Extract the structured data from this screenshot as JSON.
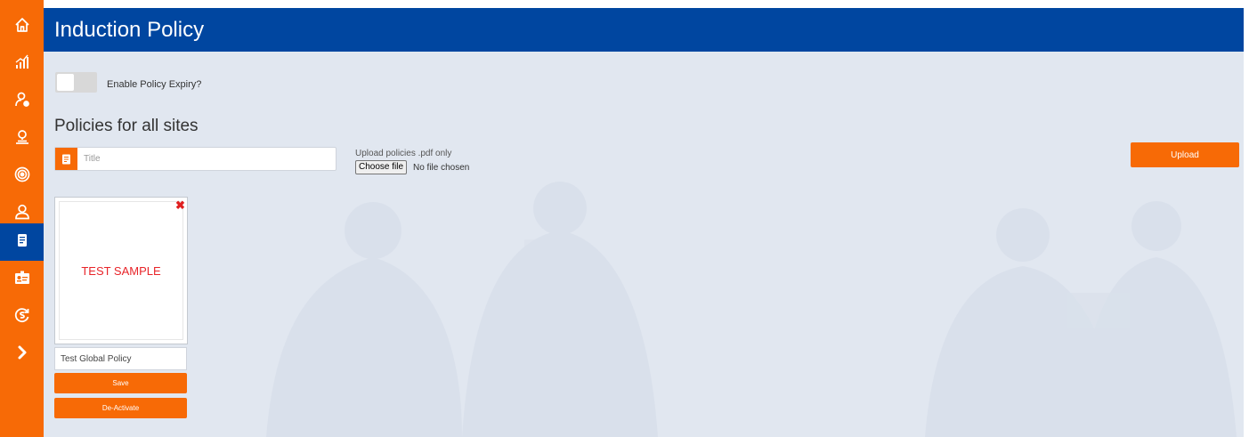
{
  "app": {
    "page_title": "Induction Policy"
  },
  "sidebar": {
    "items": [
      {
        "icon": "home-icon",
        "active": false
      },
      {
        "icon": "analytics-icon",
        "active": false
      },
      {
        "icon": "user-settings-icon",
        "active": false
      },
      {
        "icon": "location-user-icon",
        "active": false
      },
      {
        "icon": "target-icon",
        "active": false
      },
      {
        "icon": "user-icon",
        "active": false
      },
      {
        "icon": "document-icon",
        "active": true
      },
      {
        "icon": "id-card-icon",
        "active": false
      },
      {
        "icon": "refresh-dollar-icon",
        "active": false
      },
      {
        "icon": "chevron-right-icon",
        "active": false
      }
    ]
  },
  "expiry": {
    "label": "Enable Policy Expiry?",
    "enabled": false
  },
  "policies": {
    "section_title": "Policies for all sites",
    "title_placeholder": "Title",
    "title_value": "",
    "upload_label": "Upload policies .pdf only",
    "choose_file_label": "Choose file",
    "file_status": "No file chosen",
    "upload_button": "Upload"
  },
  "policy_card": {
    "preview_text": "TEST SAMPLE",
    "close_symbol": "✖",
    "name_value": "Test Global Policy",
    "save_button": "Save",
    "deactivate_button": "De-Activate"
  },
  "colors": {
    "accent_orange": "#f76a06",
    "header_blue": "#0046a0",
    "content_bg": "#e1e7f0",
    "preview_red": "#e8252a"
  }
}
